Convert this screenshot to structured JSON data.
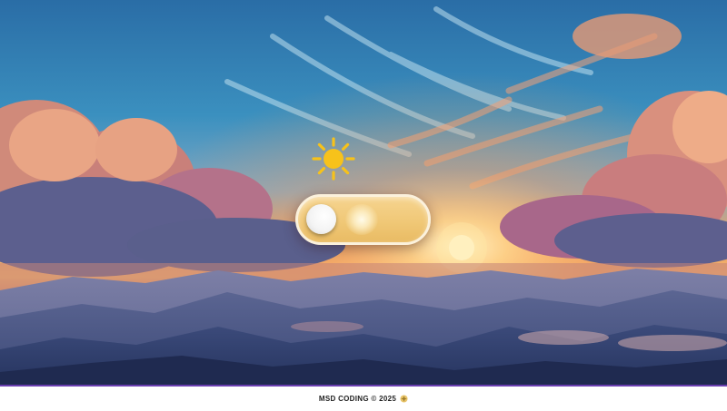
{
  "toggle": {
    "state": "day",
    "on": false
  },
  "footer": {
    "text": "MSD CODING © 2025"
  },
  "icons": {
    "sun": "sun-icon",
    "footer_badge": "sparkle-icon"
  },
  "colors": {
    "toggle_bg": "#f0c877",
    "knob": "#f4f4f4",
    "sun": "#f7c21a",
    "footer_border": "#6a3fb0"
  }
}
